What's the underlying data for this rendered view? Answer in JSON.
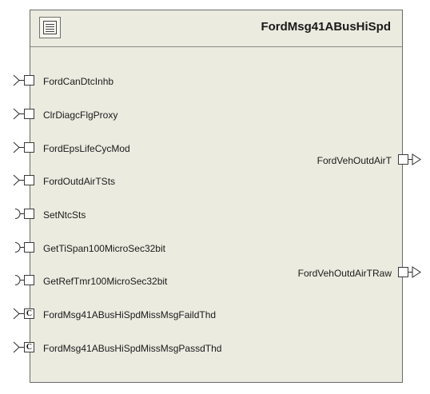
{
  "component": {
    "title": "FordMsg41ABusHiSpd",
    "icon": "component-icon"
  },
  "ports_in": [
    {
      "label": "FordCanDtcInhb",
      "kind": "receiver"
    },
    {
      "label": "ClrDiagcFlgProxy",
      "kind": "receiver"
    },
    {
      "label": "FordEpsLifeCycMod",
      "kind": "receiver"
    },
    {
      "label": "FordOutdAirTSts",
      "kind": "receiver"
    },
    {
      "label": "SetNtcSts",
      "kind": "client"
    },
    {
      "label": "GetTiSpan100MicroSec32bit",
      "kind": "client"
    },
    {
      "label": "GetRefTmr100MicroSec32bit",
      "kind": "client"
    },
    {
      "label": "FordMsg41ABusHiSpdMissMsgFaildThd",
      "kind": "calibration",
      "badge": "C"
    },
    {
      "label": "FordMsg41ABusHiSpdMissMsgPassdThd",
      "kind": "calibration",
      "badge": "C"
    }
  ],
  "ports_out": [
    {
      "label": "FordVehOutdAirT",
      "kind": "sender"
    },
    {
      "label": "FordVehOutdAirTRaw",
      "kind": "sender"
    }
  ],
  "colors": {
    "component_fill": "#ecebe0",
    "border": "#6b6b6b",
    "port_fill": "#ffffff"
  }
}
